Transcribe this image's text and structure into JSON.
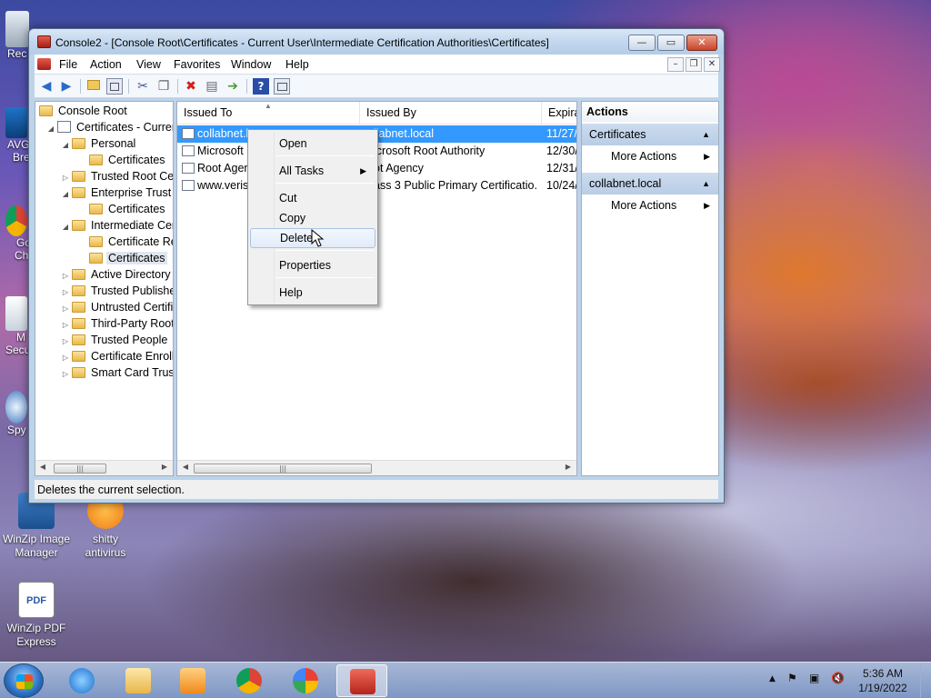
{
  "desktop": {
    "edge_labels": [
      "Rec",
      "AVG",
      "Bre",
      "Go",
      "Ch",
      "M",
      "Secu",
      "Spy"
    ],
    "icons": [
      {
        "label_line1": "WinZip Image",
        "label_line2": "Manager",
        "icon": "winzip-image-icon"
      },
      {
        "label_line1": "shitty",
        "label_line2": "antivirus",
        "icon": "antivirus-icon"
      },
      {
        "label_line1": "WinZip PDF",
        "label_line2": "Express",
        "icon": "pdf-icon",
        "badge": "PDF"
      }
    ]
  },
  "window": {
    "title": "Console2 - [Console Root\\Certificates - Current User\\Intermediate Certification Authorities\\Certificates]",
    "caption_buttons": {
      "minimize": "—",
      "maximize": "▭",
      "close": "✕"
    },
    "menu": [
      "File",
      "Action",
      "View",
      "Favorites",
      "Window",
      "Help"
    ],
    "mdi_buttons": {
      "minimize": "–",
      "restore": "❐",
      "close": "✕"
    }
  },
  "tree": {
    "items": [
      {
        "label": "Console Root",
        "level": 0,
        "expander": "",
        "icon": "folder"
      },
      {
        "label": "Certificates - Curren",
        "level": 1,
        "expander": "◢",
        "icon": "cert"
      },
      {
        "label": "Personal",
        "level": 2,
        "expander": "◢",
        "icon": "folder"
      },
      {
        "label": "Certificates",
        "level": 3,
        "expander": "",
        "icon": "folder"
      },
      {
        "label": "Trusted Root Ce",
        "level": 2,
        "expander": "▷",
        "icon": "folder"
      },
      {
        "label": "Enterprise Trust",
        "level": 2,
        "expander": "◢",
        "icon": "folder"
      },
      {
        "label": "Certificates",
        "level": 3,
        "expander": "",
        "icon": "folder"
      },
      {
        "label": "Intermediate Cer",
        "level": 2,
        "expander": "◢",
        "icon": "folder"
      },
      {
        "label": "Certificate Re",
        "level": 3,
        "expander": "",
        "icon": "folder"
      },
      {
        "label": "Certificates",
        "level": 3,
        "expander": "",
        "icon": "folder",
        "selected": true
      },
      {
        "label": "Active Directory",
        "level": 2,
        "expander": "▷",
        "icon": "folder"
      },
      {
        "label": "Trusted Publishe",
        "level": 2,
        "expander": "▷",
        "icon": "folder"
      },
      {
        "label": "Untrusted Certifi",
        "level": 2,
        "expander": "▷",
        "icon": "folder"
      },
      {
        "label": "Third-Party Root",
        "level": 2,
        "expander": "▷",
        "icon": "folder"
      },
      {
        "label": "Trusted People",
        "level": 2,
        "expander": "▷",
        "icon": "folder"
      },
      {
        "label": "Certificate Enroll",
        "level": 2,
        "expander": "▷",
        "icon": "folder"
      },
      {
        "label": "Smart Card Trus",
        "level": 2,
        "expander": "▷",
        "icon": "folder"
      }
    ]
  },
  "list": {
    "columns": [
      "Issued To",
      "Issued By",
      "Expira"
    ],
    "rows": [
      {
        "issued_to": "collabnet.l",
        "issued_by": "llabnet.local",
        "expiry": "11/27/",
        "selected": true
      },
      {
        "issued_to": "Microsoft",
        "issued_by": "icrosoft Root Authority",
        "expiry": "12/30/"
      },
      {
        "issued_to": "Root Agen",
        "issued_by": "ot Agency",
        "expiry": "12/31/"
      },
      {
        "issued_to": "www.veris",
        "issued_by": "ass 3 Public Primary Certificatio...",
        "expiry": "10/24/"
      }
    ]
  },
  "context_menu": {
    "items": [
      "Open",
      "All Tasks",
      "Cut",
      "Copy",
      "Delete",
      "Properties",
      "Help"
    ],
    "hovered": "Delete"
  },
  "actions_pane": {
    "title": "Actions",
    "sections": [
      {
        "header": "Certificates",
        "item": "More Actions"
      },
      {
        "header": "collabnet.local",
        "item": "More Actions"
      }
    ]
  },
  "statusbar": {
    "text": "Deletes the current selection."
  },
  "taskbar": {
    "pinned": [
      "internet-explorer",
      "windows-explorer",
      "media-player",
      "chrome",
      "security-app",
      "mmc-console"
    ],
    "clock_time": "5:36 AM",
    "clock_date": "1/19/2022"
  },
  "colors": {
    "selection": "#3399ff",
    "actions_section": "#c3d6ec"
  }
}
